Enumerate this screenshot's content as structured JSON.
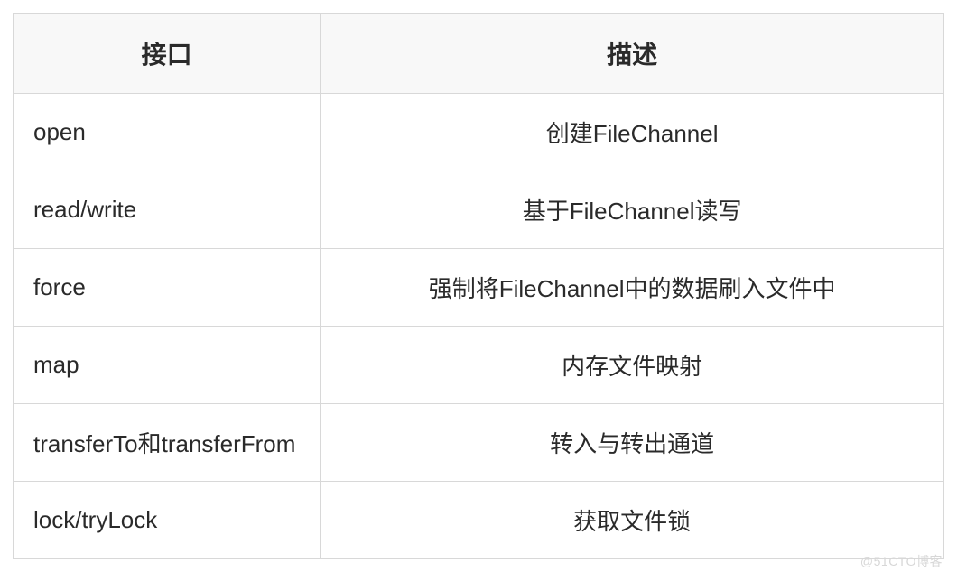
{
  "table": {
    "headers": [
      "接口",
      "描述"
    ],
    "rows": [
      {
        "interface": "open",
        "description": "创建FileChannel"
      },
      {
        "interface": "read/write",
        "description": "基于FileChannel读写"
      },
      {
        "interface": "force",
        "description": "强制将FileChannel中的数据刷入文件中"
      },
      {
        "interface": "map",
        "description": "内存文件映射"
      },
      {
        "interface": "transferTo和transferFrom",
        "description": "转入与转出通道"
      },
      {
        "interface": "lock/tryLock",
        "description": "获取文件锁"
      }
    ]
  },
  "watermark": "@51CTO博客"
}
